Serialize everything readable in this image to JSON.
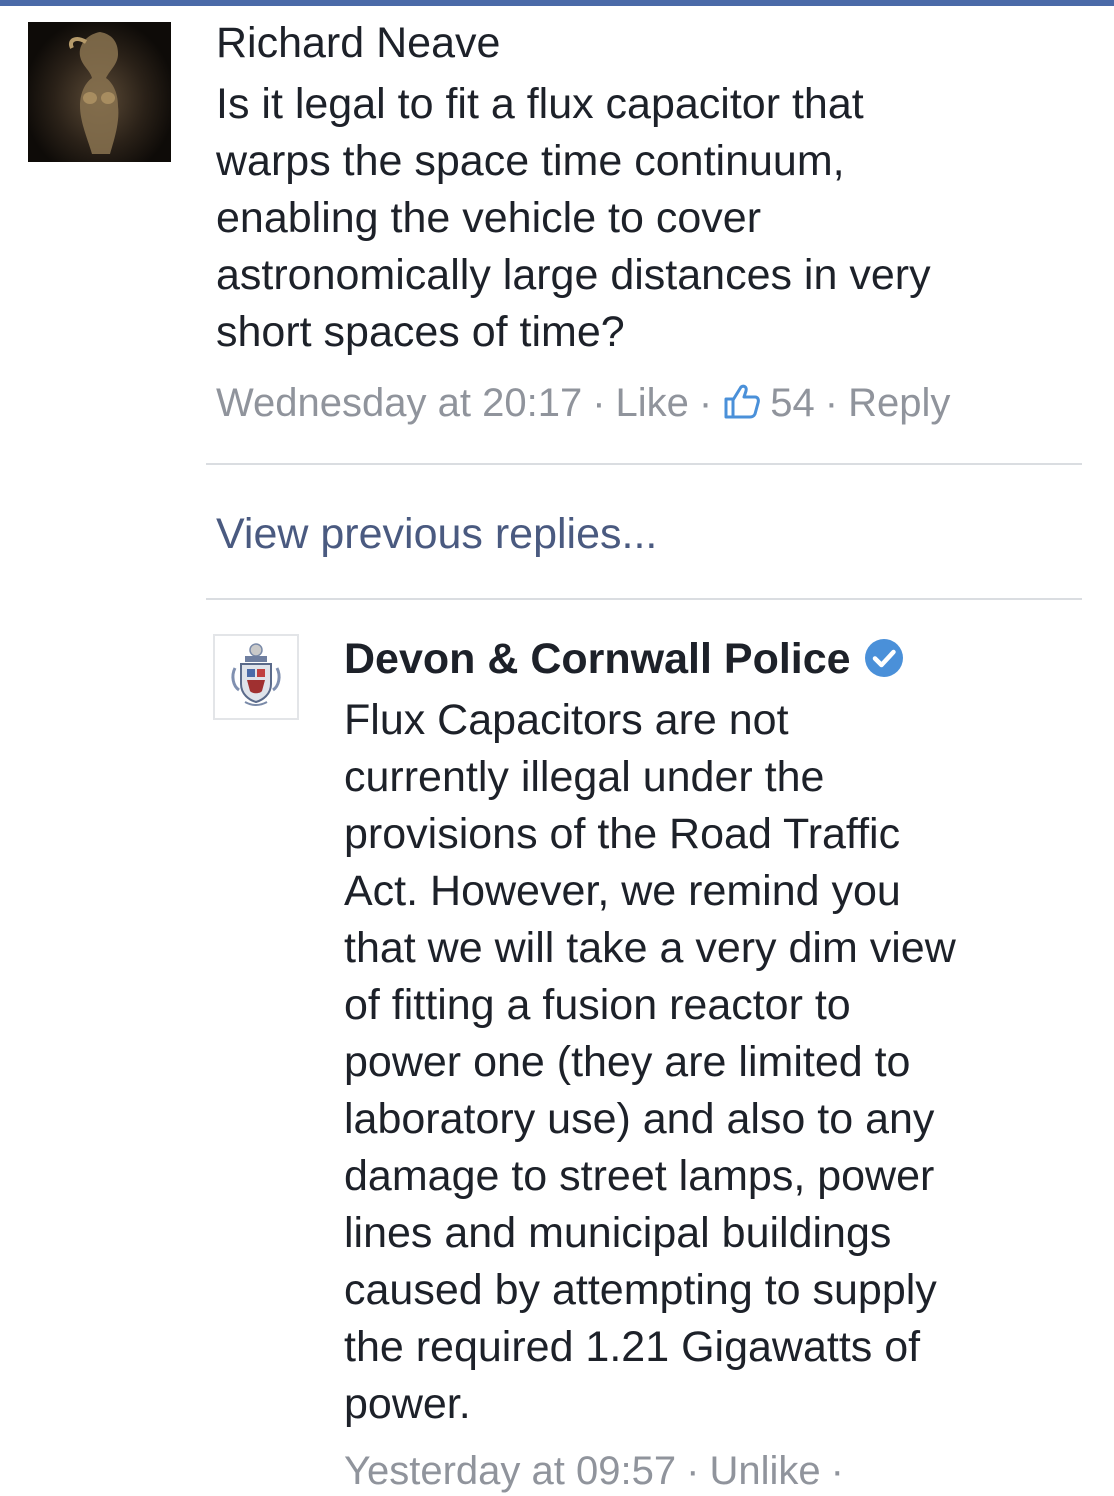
{
  "comment": {
    "author": "Richard Neave",
    "lines": [
      "Is it legal to fit a flux capacitor that",
      "warps the space time continuum,",
      "enabling the vehicle to cover",
      "astronomically large distances in very",
      "short spaces of time?"
    ],
    "timestamp": "Wednesday at 20:17",
    "like_label": "Like",
    "like_count": "54",
    "reply_label": "Reply",
    "separator": "·"
  },
  "view_previous": "View previous replies...",
  "reply": {
    "author": "Devon & Cornwall Police",
    "lines": [
      "Flux Capacitors are not",
      "currently illegal under the",
      "provisions of the Road Traffic",
      "Act. However, we remind you",
      "that we will take a very dim view",
      "of fitting a fusion reactor to",
      "power one (they are limited to",
      "laboratory use) and also to any",
      "damage to street lamps, power",
      "lines and municipal buildings",
      "caused by attempting to supply",
      "the required 1.21 Gigawatts of",
      "power."
    ],
    "timestamp": "Yesterday at 09:57",
    "unlike_label": "Unlike",
    "separator": "·"
  },
  "icons": {
    "thumbs_up": "thumbs-up-icon",
    "verified": "verified-badge-icon"
  },
  "colors": {
    "text": "#1d2129",
    "meta": "#90949c",
    "link": "#4a5a80",
    "verified": "#4a90d9",
    "divider": "#dadde1"
  }
}
